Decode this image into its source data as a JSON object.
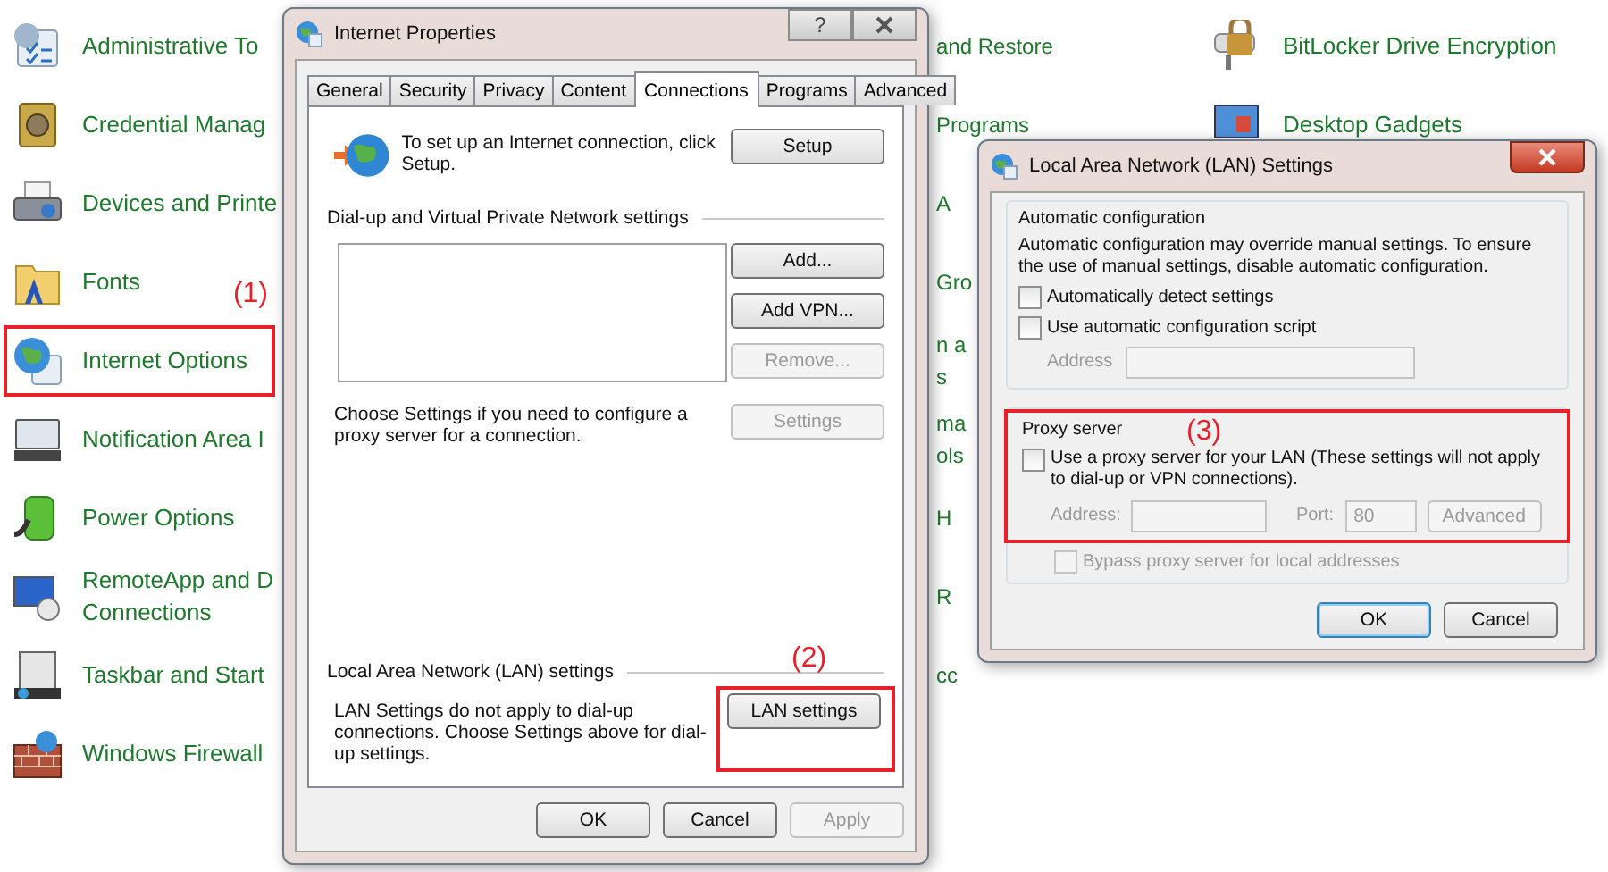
{
  "control_panel": {
    "left_items": [
      {
        "lines": [
          "Administrative To"
        ]
      },
      {
        "lines": [
          "Credential Manag"
        ]
      },
      {
        "lines": [
          "Devices and Printe"
        ]
      },
      {
        "lines": [
          "Fonts"
        ]
      },
      {
        "lines": [
          "Internet Options"
        ],
        "callout": "(1)"
      },
      {
        "lines": [
          "Notification Area I"
        ]
      },
      {
        "lines": [
          "Power Options"
        ]
      },
      {
        "lines": [
          "RemoteApp and D",
          "Connections"
        ]
      },
      {
        "lines": [
          "Taskbar and Start"
        ]
      },
      {
        "lines": [
          "Windows Firewall"
        ]
      }
    ],
    "middle_items": [
      {
        "lines": [
          "and Restore"
        ]
      },
      {
        "lines": [
          "Programs"
        ]
      },
      {
        "lines": [
          "A"
        ]
      },
      {
        "lines": [
          "Gro"
        ]
      },
      {
        "lines": [
          "n a",
          "s"
        ]
      },
      {
        "lines": [
          "ma",
          "ols"
        ]
      },
      {
        "lines": [
          "H"
        ]
      },
      {
        "lines": [
          "R"
        ]
      },
      {
        "lines": [
          "cc"
        ]
      }
    ],
    "right_items": [
      {
        "lines": [
          "BitLocker Drive Encryption"
        ]
      },
      {
        "lines": [
          "Desktop Gadgets"
        ]
      }
    ]
  },
  "internet_properties": {
    "title": "Internet Properties",
    "help": "?",
    "tabs": [
      {
        "label": "General",
        "selected": false
      },
      {
        "label": "Security",
        "selected": false
      },
      {
        "label": "Privacy",
        "selected": false
      },
      {
        "label": "Content",
        "selected": false
      },
      {
        "label": "Connections",
        "selected": true
      },
      {
        "label": "Programs",
        "selected": false
      },
      {
        "label": "Advanced",
        "selected": false
      }
    ],
    "setup_text": "To set up an Internet connection, click Setup.",
    "setup_button": {
      "label": "Setup"
    },
    "vpn_group": "Dial-up and Virtual Private Network settings",
    "vpn_buttons": [
      {
        "label": "Add...",
        "disabled": false
      },
      {
        "label": "Add VPN...",
        "disabled": false
      },
      {
        "label": "Remove...",
        "disabled": true
      }
    ],
    "proxy_text": "Choose Settings if you need to configure a proxy server for a connection.",
    "settings_button": {
      "label": "Settings",
      "disabled": true
    },
    "lan_group": "Local Area Network (LAN) settings",
    "lan_text": "LAN Settings do not apply to dial-up connections. Choose Settings above for dial-up settings.",
    "lan_button": {
      "label": "LAN settings",
      "callout": "(2)"
    },
    "buttons": [
      {
        "label": "OK",
        "disabled": false
      },
      {
        "label": "Cancel",
        "disabled": false
      },
      {
        "label": "Apply",
        "disabled": true
      }
    ]
  },
  "lan_settings": {
    "title": "Local Area Network (LAN) Settings",
    "auto_group": "Automatic configuration",
    "auto_text": "Automatic configuration may override manual settings.  To ensure the use of manual settings, disable automatic configuration.",
    "auto_options": [
      {
        "label": "Automatically detect settings",
        "checked": false,
        "disabled": false
      },
      {
        "label": "Use automatic configuration script",
        "checked": false,
        "disabled": false
      }
    ],
    "script_address_label": "Address",
    "proxy_group": "Proxy server",
    "proxy_callout": "(3)",
    "use_proxy": {
      "label": "Use a proxy server for your LAN (These settings will not apply to dial-up or VPN connections).",
      "checked": false,
      "disabled": false
    },
    "address_label": "Address:",
    "port_label": "Port:",
    "port_value": "80",
    "advanced_button": {
      "label": "Advanced",
      "disabled": true
    },
    "bypass": {
      "label": "Bypass proxy server for local addresses",
      "checked": false,
      "disabled": true
    },
    "buttons": [
      {
        "label": "OK",
        "disabled": false,
        "default": true
      },
      {
        "label": "Cancel",
        "disabled": false,
        "default": false
      }
    ]
  }
}
